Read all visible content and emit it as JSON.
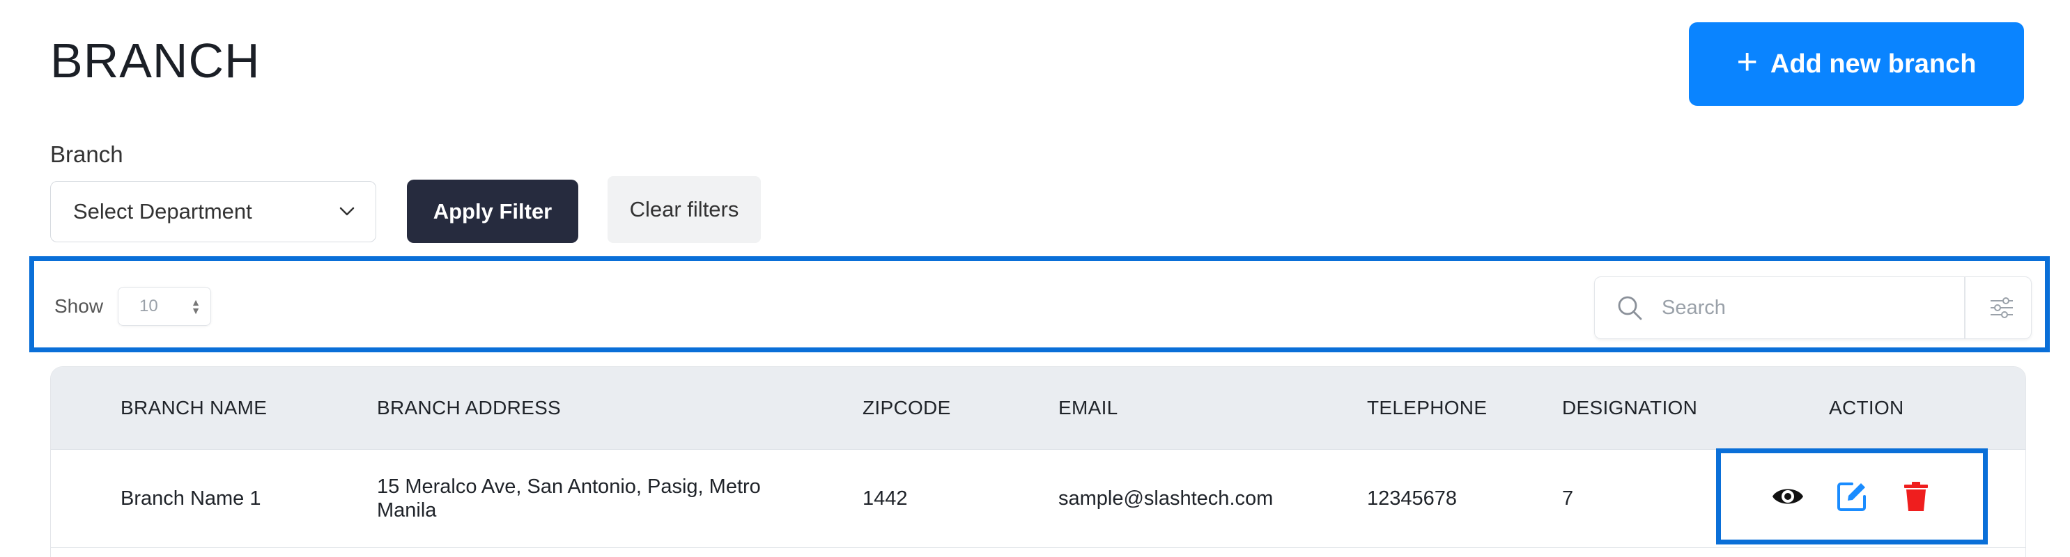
{
  "page": {
    "title": "BRANCH",
    "add_button_label": "Add new branch"
  },
  "filters": {
    "label": "Branch",
    "department_select": "Select Department",
    "apply_label": "Apply Filter",
    "clear_label": "Clear filters"
  },
  "toolbar": {
    "show_label": "Show",
    "page_size": "10",
    "search_placeholder": "Search"
  },
  "table": {
    "columns": [
      "BRANCH NAME",
      "BRANCH ADDRESS",
      "ZIPCODE",
      "EMAIL",
      "TELEPHONE",
      "DESIGNATION",
      "ACTION"
    ],
    "rows": [
      {
        "branch_name": "Branch Name 1",
        "branch_address": "15 Meralco Ave, San Antonio, Pasig, Metro Manila",
        "zipcode": "1442",
        "email": "sample@slashtech.com",
        "telephone": "12345678",
        "designation": "7",
        "actions": [
          "eye-icon",
          "edit-icon",
          "trash-icon"
        ]
      }
    ]
  },
  "colors": {
    "primary": "#0a84ff",
    "highlight_border": "#0a6fd8",
    "dark_button": "#262b3e",
    "edit_icon": "#1a8cff",
    "delete_icon": "#ef1e1e",
    "table_header_bg": "#eaedf1"
  }
}
